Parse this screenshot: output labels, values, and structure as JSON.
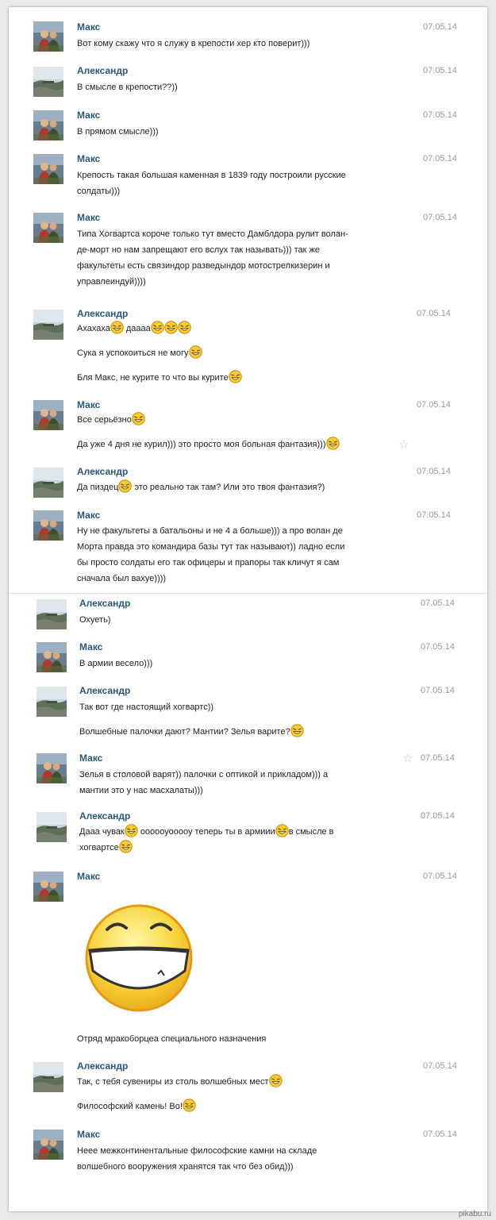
{
  "users": {
    "maks": "Макс",
    "alex": "Александр"
  },
  "date": "07.05.14",
  "messages": [
    {
      "sender": "Макс",
      "lines": [
        "Вот кому скажу что я служу в крепости хер кто поверит)))"
      ]
    },
    {
      "sender": "Александр",
      "lines": [
        "В смысле в крепости??))"
      ]
    },
    {
      "sender": "Макс",
      "lines": [
        "В прямом смысле)))"
      ]
    },
    {
      "sender": "Макс",
      "lines": [
        "Крепость такая большая каменная в 1839 году построили русские",
        "солдаты)))"
      ]
    },
    {
      "sender": "Макс",
      "lines": [
        "Типа Хогвартса короче только тут вместо Дамблдора рулит волан-",
        "де-морт но нам запрещают его вслух так называть))) так же",
        "факультеты есть связиндор разведындор мотострелкизерин и",
        "управлеиндуй))))"
      ]
    },
    {
      "sender": "Александр",
      "lines": [
        "Ахахаха",
        "даааа",
        "Сука я успокоиться не могу",
        "Бля Макс, не курите то что вы курите"
      ]
    },
    {
      "sender": "Макс",
      "lines": [
        "Все серьёзно",
        "Да уже 4 дня не курил))) это просто моя больная фантазия)))"
      ]
    },
    {
      "sender": "Александр",
      "lines": [
        "Да пиздец",
        "это реально так там? Или это твоя фантазия?)"
      ]
    },
    {
      "sender": "Макс",
      "lines": [
        "Ну не факультеты а батальоны и не 4 а больше))) а про волан де",
        "Морта правда это командира базы тут так называют)) ладно если",
        "бы просто солдаты его так офицеры и прапоры так кличут я сам",
        "сначала был вахуе))))"
      ]
    },
    {
      "sender": "Александр",
      "lines": [
        "Охуеть)"
      ]
    },
    {
      "sender": "Макс",
      "lines": [
        "В армии весело)))"
      ]
    },
    {
      "sender": "Александр",
      "lines": [
        "Так вот где настоящий хогвартс))",
        "Волшебные палочки дают? Мантии? Зелья варите?"
      ]
    },
    {
      "sender": "Макс",
      "lines": [
        "Зелья в столовой варят)) палочки с оптикой и прикладом))) а",
        "мантии это у нас масхалаты)))"
      ]
    },
    {
      "sender": "Александр",
      "lines": [
        "Дааа чувак",
        "оооооуооооу теперь ты в армиии",
        "в смысле в",
        "хогвартсе"
      ]
    },
    {
      "sender": "Макс",
      "lines": [
        "Отряд мракоборцеа специального назначения"
      ]
    },
    {
      "sender": "Александр",
      "lines": [
        "Так, с тебя сувениры из столь волшебных мест",
        "Философский камень! Во!"
      ]
    },
    {
      "sender": "Макс",
      "lines": [
        "Неее межконтинентальные философские камни на складе",
        "волшебного вооружения хранятся так что без обид)))"
      ]
    }
  ],
  "star_icon": "☆",
  "watermark": "pikabu.ru",
  "colors": {
    "name": "#2b587a",
    "text": "#222222",
    "date": "#999999",
    "smiley": "#f2c521"
  }
}
